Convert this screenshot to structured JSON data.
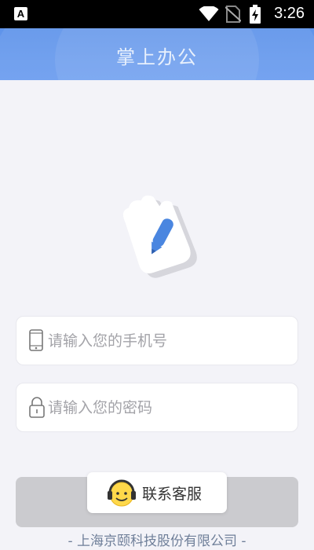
{
  "status_bar": {
    "app_icon_letter": "A",
    "time": "3:26"
  },
  "header": {
    "title": "掌上办公"
  },
  "login": {
    "phone_placeholder": "请输入您的手机号",
    "password_placeholder": "请输入您的密码"
  },
  "customer_service": {
    "label": "联系客服"
  },
  "footer": {
    "text": "- 上海京颐科技股份有限公司 -"
  },
  "colors": {
    "header_bg": "#6a9cef",
    "page_bg": "#f3f3f8",
    "logo_pen": "#4a86e0",
    "button_bg": "#cbcbcf"
  },
  "icons": {
    "phone_field": "mobile-phone-icon",
    "password_field": "lock-icon",
    "customer_service": "headset-smiley-icon"
  }
}
